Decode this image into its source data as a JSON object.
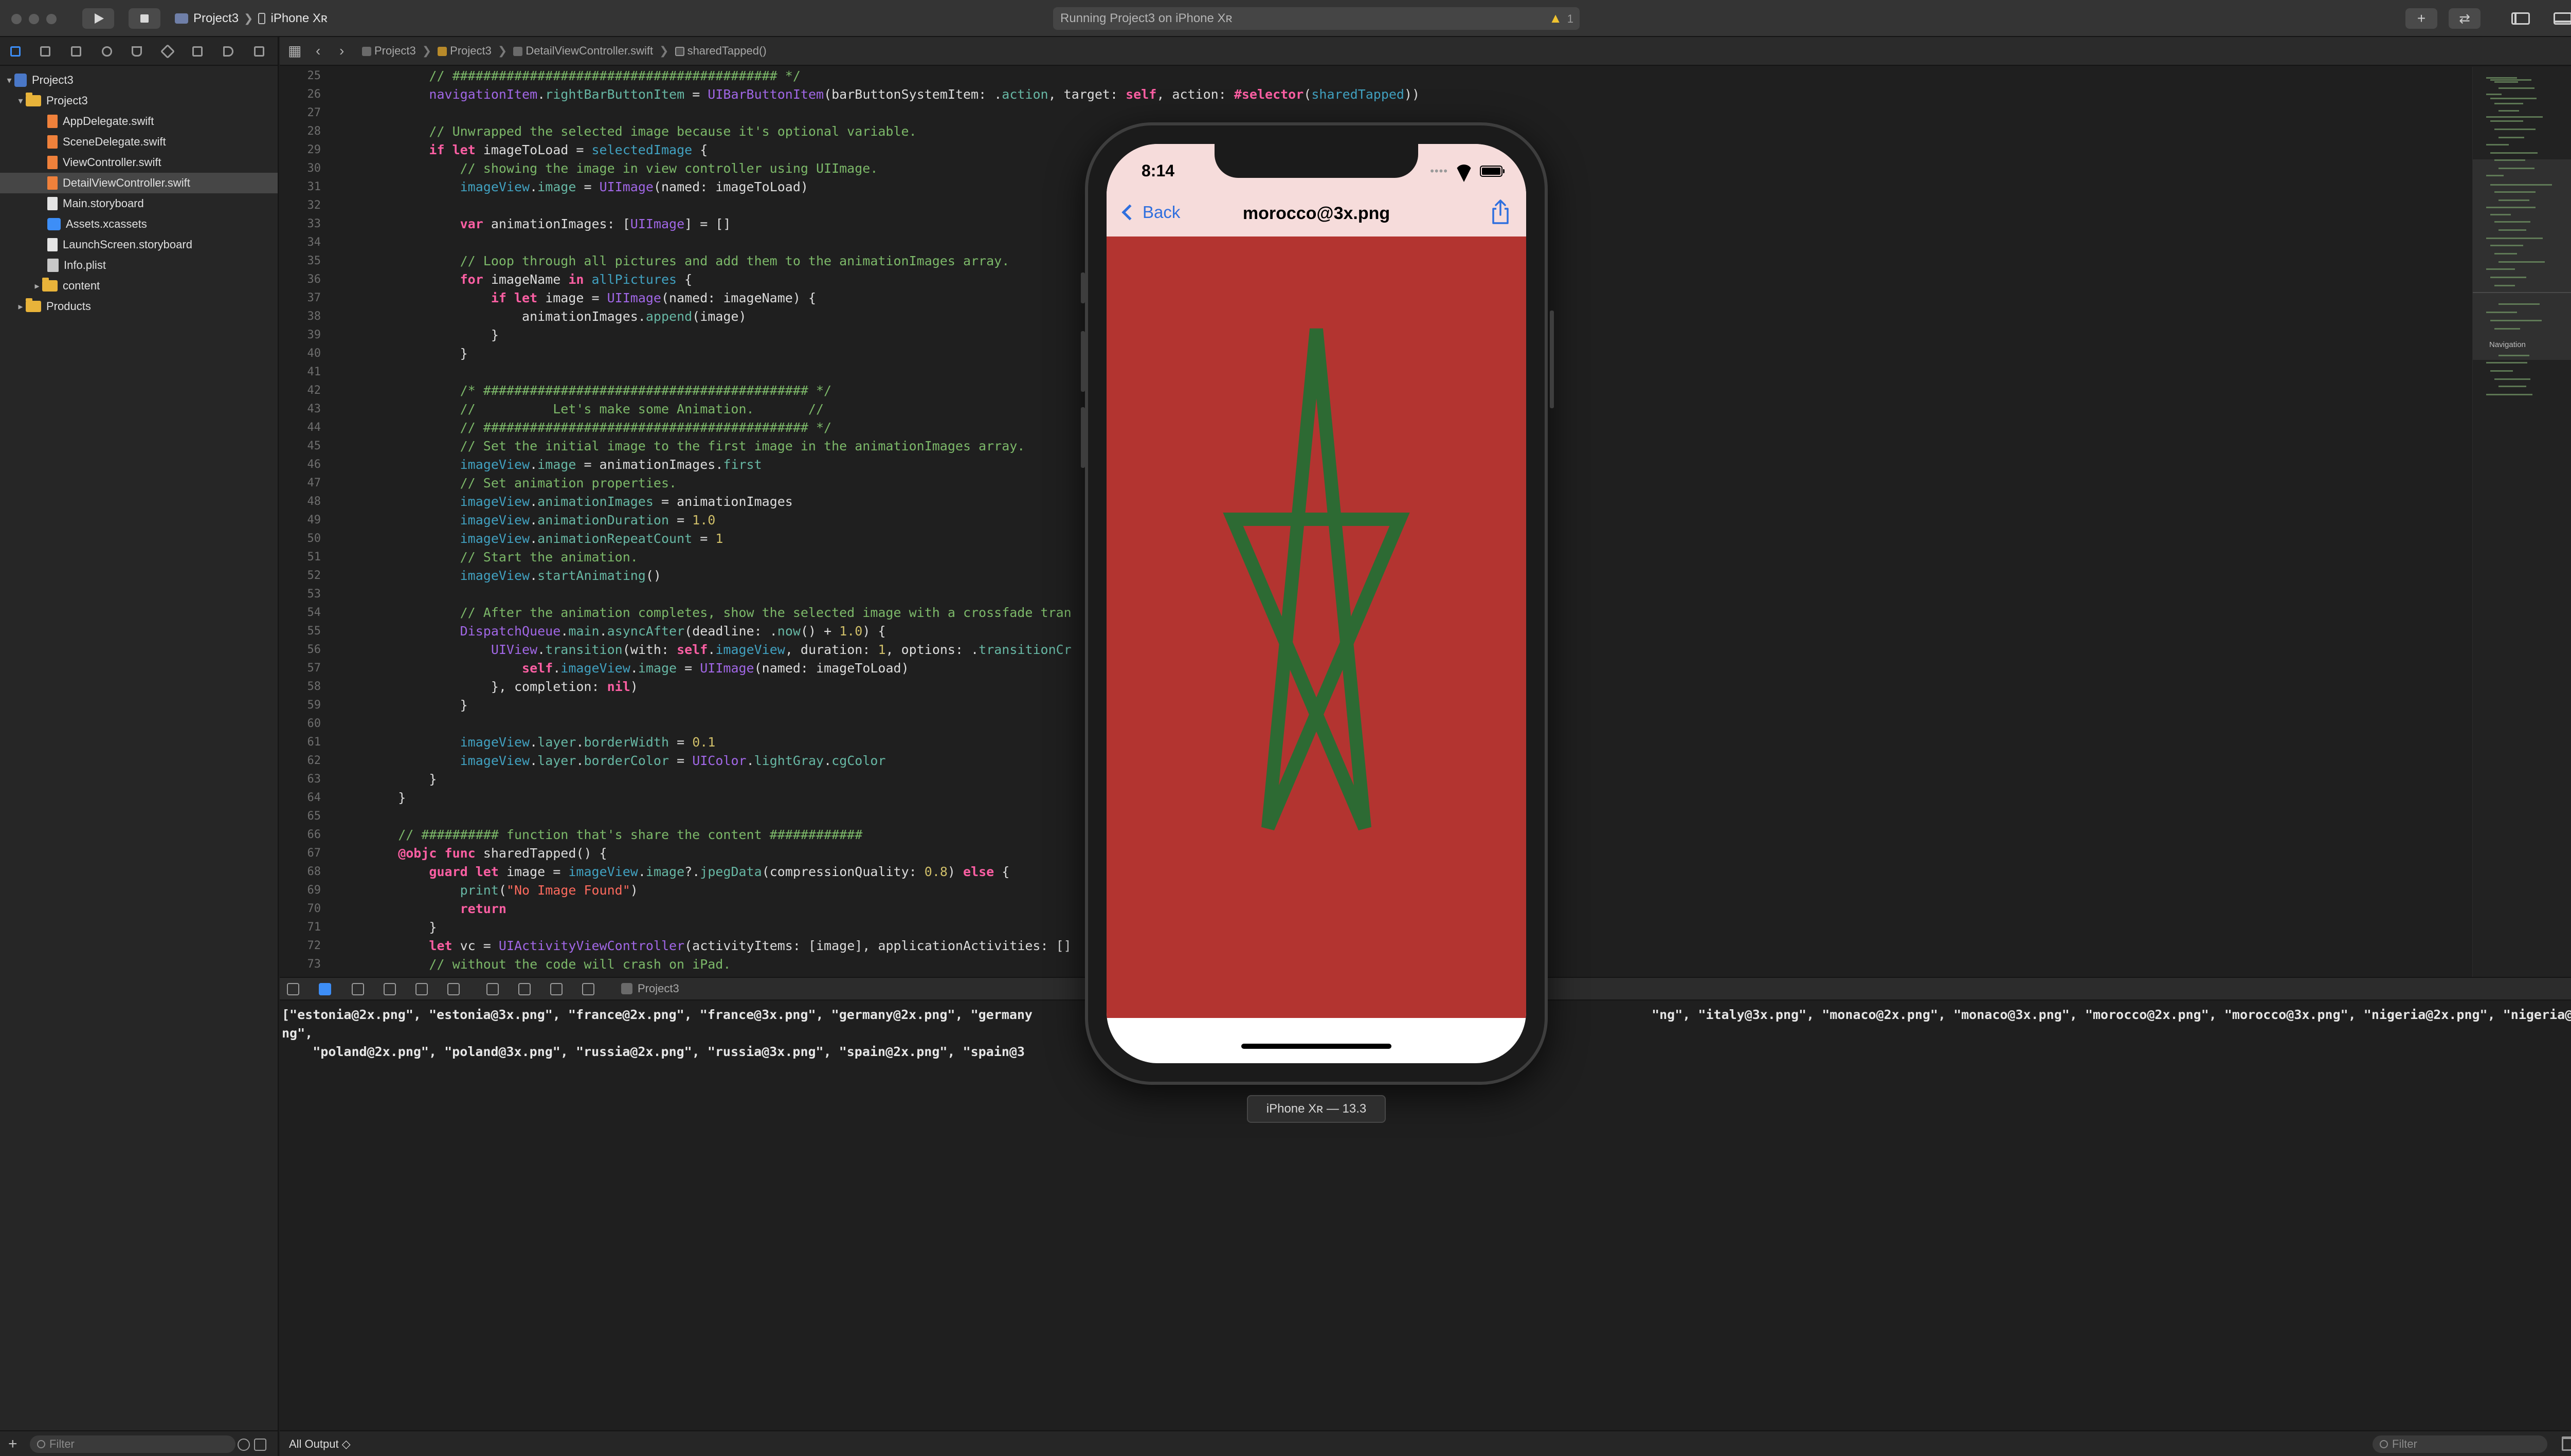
{
  "toolbar": {
    "scheme": "Project3",
    "device": "iPhone Xʀ",
    "status": "Running Project3 on iPhone Xʀ",
    "warning_count": "1"
  },
  "navigator": {
    "items": [
      {
        "label": "Project3",
        "kind": "project",
        "expanded": true
      },
      {
        "label": "Project3",
        "kind": "folder",
        "expanded": true
      },
      {
        "label": "AppDelegate.swift",
        "kind": "swift"
      },
      {
        "label": "SceneDelegate.swift",
        "kind": "swift"
      },
      {
        "label": "ViewController.swift",
        "kind": "swift"
      },
      {
        "label": "DetailViewController.swift",
        "kind": "swift",
        "selected": true
      },
      {
        "label": "Main.storyboard",
        "kind": "storyboard"
      },
      {
        "label": "Assets.xcassets",
        "kind": "assets"
      },
      {
        "label": "LaunchScreen.storyboard",
        "kind": "storyboard"
      },
      {
        "label": "Info.plist",
        "kind": "plist"
      },
      {
        "label": "content",
        "kind": "folder",
        "collapsed": true
      },
      {
        "label": "Products",
        "kind": "folder",
        "collapsed": true
      }
    ],
    "filter_placeholder": "Filter"
  },
  "jumpbar": {
    "crumbs": [
      "Project3",
      "Project3",
      "DetailViewController.swift",
      "sharedTapped()"
    ]
  },
  "editor": {
    "lines": [
      [
        25,
        [
          [
            "c",
            "        // ########################################## */"
          ]
        ]
      ],
      [
        26,
        [
          [
            "t",
            "        navigationItem"
          ],
          [
            "d",
            "."
          ],
          [
            "p",
            "rightBarButtonItem"
          ],
          [
            "d",
            " = "
          ],
          [
            "t",
            "UIBarButtonItem"
          ],
          [
            "d",
            "(barButtonSystemItem: ."
          ],
          [
            "p",
            "action"
          ],
          [
            "d",
            ", target: "
          ],
          [
            "k",
            "self"
          ],
          [
            "d",
            ", action: "
          ],
          [
            "k",
            "#selector"
          ],
          [
            "d",
            "("
          ],
          [
            "f",
            "sharedTapped"
          ],
          [
            "d",
            "))"
          ]
        ]
      ],
      [
        27,
        [
          [
            "d",
            ""
          ]
        ]
      ],
      [
        28,
        [
          [
            "c",
            "        // Unwrapped the selected image because it's optional variable."
          ]
        ]
      ],
      [
        29,
        [
          [
            "k",
            "        if let "
          ],
          [
            "d",
            "imageToLoad = "
          ],
          [
            "f",
            "selectedImage"
          ],
          [
            "d",
            " {"
          ]
        ]
      ],
      [
        30,
        [
          [
            "c",
            "            // showing the image in view controller using UIImage."
          ]
        ]
      ],
      [
        31,
        [
          [
            "f",
            "            imageView"
          ],
          [
            "d",
            "."
          ],
          [
            "p",
            "image"
          ],
          [
            "d",
            " = "
          ],
          [
            "t",
            "UIImage"
          ],
          [
            "d",
            "(named: imageToLoad)"
          ]
        ]
      ],
      [
        32,
        [
          [
            "d",
            ""
          ]
        ]
      ],
      [
        33,
        [
          [
            "k",
            "            var "
          ],
          [
            "d",
            "animationImages: ["
          ],
          [
            "t",
            "UIImage"
          ],
          [
            "d",
            "] = []"
          ]
        ]
      ],
      [
        34,
        [
          [
            "d",
            ""
          ]
        ]
      ],
      [
        35,
        [
          [
            "c",
            "            // Loop through all pictures and add them to the animationImages array."
          ]
        ]
      ],
      [
        36,
        [
          [
            "k",
            "            for "
          ],
          [
            "d",
            "imageName "
          ],
          [
            "k",
            "in "
          ],
          [
            "f",
            "allPictures"
          ],
          [
            "d",
            " {"
          ]
        ]
      ],
      [
        37,
        [
          [
            "k",
            "                if let "
          ],
          [
            "d",
            "image = "
          ],
          [
            "t",
            "UIImage"
          ],
          [
            "d",
            "(named: imageName) {"
          ]
        ]
      ],
      [
        38,
        [
          [
            "d",
            "                    animationImages."
          ],
          [
            "p",
            "append"
          ],
          [
            "d",
            "(image)"
          ]
        ]
      ],
      [
        39,
        [
          [
            "d",
            "                }"
          ]
        ]
      ],
      [
        40,
        [
          [
            "d",
            "            }"
          ]
        ]
      ],
      [
        41,
        [
          [
            "d",
            ""
          ]
        ]
      ],
      [
        42,
        [
          [
            "c",
            "            /* ########################################## */"
          ]
        ]
      ],
      [
        43,
        [
          [
            "c",
            "            //          Let's make some Animation.       //"
          ]
        ]
      ],
      [
        44,
        [
          [
            "c",
            "            // ########################################## */"
          ]
        ]
      ],
      [
        45,
        [
          [
            "c",
            "            // Set the initial image to the first image in the animationImages array."
          ]
        ]
      ],
      [
        46,
        [
          [
            "f",
            "            imageView"
          ],
          [
            "d",
            "."
          ],
          [
            "p",
            "image"
          ],
          [
            "d",
            " = animationImages."
          ],
          [
            "p",
            "first"
          ]
        ]
      ],
      [
        47,
        [
          [
            "c",
            "            // Set animation properties."
          ]
        ]
      ],
      [
        48,
        [
          [
            "f",
            "            imageView"
          ],
          [
            "d",
            "."
          ],
          [
            "p",
            "animationImages"
          ],
          [
            "d",
            " = animationImages"
          ]
        ]
      ],
      [
        49,
        [
          [
            "f",
            "            imageView"
          ],
          [
            "d",
            "."
          ],
          [
            "p",
            "animationDuration"
          ],
          [
            "d",
            " = "
          ],
          [
            "n",
            "1.0"
          ]
        ]
      ],
      [
        50,
        [
          [
            "f",
            "            imageView"
          ],
          [
            "d",
            "."
          ],
          [
            "p",
            "animationRepeatCount"
          ],
          [
            "d",
            " = "
          ],
          [
            "n",
            "1"
          ]
        ]
      ],
      [
        51,
        [
          [
            "c",
            "            // Start the animation."
          ]
        ]
      ],
      [
        52,
        [
          [
            "f",
            "            imageView"
          ],
          [
            "d",
            "."
          ],
          [
            "p",
            "startAnimating"
          ],
          [
            "d",
            "()"
          ]
        ]
      ],
      [
        53,
        [
          [
            "d",
            ""
          ]
        ]
      ],
      [
        54,
        [
          [
            "c",
            "            // After the animation completes, show the selected image with a crossfade tran"
          ]
        ]
      ],
      [
        55,
        [
          [
            "t",
            "            DispatchQueue"
          ],
          [
            "d",
            "."
          ],
          [
            "p",
            "main"
          ],
          [
            "d",
            "."
          ],
          [
            "p",
            "asyncAfter"
          ],
          [
            "d",
            "(deadline: ."
          ],
          [
            "p",
            "now"
          ],
          [
            "d",
            "() + "
          ],
          [
            "n",
            "1.0"
          ],
          [
            "d",
            ") {"
          ]
        ]
      ],
      [
        56,
        [
          [
            "t",
            "                UIView"
          ],
          [
            "d",
            "."
          ],
          [
            "p",
            "transition"
          ],
          [
            "d",
            "(with: "
          ],
          [
            "k",
            "self"
          ],
          [
            "d",
            "."
          ],
          [
            "f",
            "imageView"
          ],
          [
            "d",
            ", duration: "
          ],
          [
            "n",
            "1"
          ],
          [
            "d",
            ", options: ."
          ],
          [
            "p",
            "transitionCr"
          ]
        ]
      ],
      [
        57,
        [
          [
            "k",
            "                    self"
          ],
          [
            "d",
            "."
          ],
          [
            "f",
            "imageView"
          ],
          [
            "d",
            "."
          ],
          [
            "p",
            "image"
          ],
          [
            "d",
            " = "
          ],
          [
            "t",
            "UIImage"
          ],
          [
            "d",
            "(named: imageToLoad)"
          ]
        ]
      ],
      [
        58,
        [
          [
            "d",
            "                }, completion: "
          ],
          [
            "k",
            "nil"
          ],
          [
            "d",
            ")"
          ]
        ]
      ],
      [
        59,
        [
          [
            "d",
            "            }"
          ]
        ]
      ],
      [
        60,
        [
          [
            "d",
            ""
          ]
        ]
      ],
      [
        61,
        [
          [
            "f",
            "            imageView"
          ],
          [
            "d",
            "."
          ],
          [
            "p",
            "layer"
          ],
          [
            "d",
            "."
          ],
          [
            "p",
            "borderWidth"
          ],
          [
            "d",
            " = "
          ],
          [
            "n",
            "0.1"
          ]
        ]
      ],
      [
        62,
        [
          [
            "f",
            "            imageView"
          ],
          [
            "d",
            "."
          ],
          [
            "p",
            "layer"
          ],
          [
            "d",
            "."
          ],
          [
            "p",
            "borderColor"
          ],
          [
            "d",
            " = "
          ],
          [
            "t",
            "UIColor"
          ],
          [
            "d",
            "."
          ],
          [
            "p",
            "lightGray"
          ],
          [
            "d",
            "."
          ],
          [
            "p",
            "cgColor"
          ]
        ]
      ],
      [
        63,
        [
          [
            "d",
            "        }"
          ]
        ]
      ],
      [
        64,
        [
          [
            "d",
            "    }"
          ]
        ]
      ],
      [
        65,
        [
          [
            "d",
            ""
          ]
        ]
      ],
      [
        66,
        [
          [
            "c",
            "    // ########## function that's share the content ############"
          ]
        ]
      ],
      [
        67,
        [
          [
            "k",
            "    @objc func "
          ],
          [
            "d",
            "sharedTapped() {"
          ]
        ]
      ],
      [
        68,
        [
          [
            "k",
            "        guard let "
          ],
          [
            "d",
            "image = "
          ],
          [
            "f",
            "imageView"
          ],
          [
            "d",
            "."
          ],
          [
            "p",
            "image"
          ],
          [
            "d",
            "?."
          ],
          [
            "p",
            "jpegData"
          ],
          [
            "d",
            "(compressionQuality: "
          ],
          [
            "n",
            "0.8"
          ],
          [
            "d",
            ") "
          ],
          [
            "k",
            "else"
          ],
          [
            "d",
            " {"
          ]
        ]
      ],
      [
        69,
        [
          [
            "p",
            "            print"
          ],
          [
            "d",
            "("
          ],
          [
            "s",
            "\"No Image Found\""
          ],
          [
            "d",
            ")"
          ]
        ]
      ],
      [
        70,
        [
          [
            "k",
            "            return"
          ]
        ]
      ],
      [
        71,
        [
          [
            "d",
            "        }"
          ]
        ]
      ],
      [
        72,
        [
          [
            "k",
            "        let "
          ],
          [
            "d",
            "vc = "
          ],
          [
            "t",
            "UIActivityViewController"
          ],
          [
            "d",
            "(activityItems: [image], applicationActivities: []"
          ]
        ]
      ],
      [
        73,
        [
          [
            "c",
            "        // without the code will crash on iPad."
          ]
        ]
      ]
    ]
  },
  "minimap": {
    "label": "Navigation"
  },
  "debug": {
    "target": "Project3"
  },
  "console": {
    "output": "[\"estonia@2x.png\", \"estonia@3x.png\", \"france@2x.png\", \"france@3x.png\", \"germany@2x.png\", \"germany                                                                                \"ng\", \"italy@3x.png\", \"monaco@2x.png\", \"monaco@3x.png\", \"morocco@2x.png\", \"morocco@3x.png\", \"nigeria@2x.png\", \"nigeria@3x.png\",\n    \"poland@2x.png\", \"poland@3x.png\", \"russia@2x.png\", \"russia@3x.png\", \"spain@2x.png\", \"spain@3                        \"]",
    "output_selector": "All Output ◇",
    "filter_placeholder": "Filter"
  },
  "simulator": {
    "time": "8:14",
    "back_label": "Back",
    "nav_title": "morocco@3x.png",
    "device_label": "iPhone Xʀ — 13.3",
    "flag_color": "#b33430",
    "star_color": "#2d6a33",
    "nav_bar_color": "#f6dcdb"
  }
}
